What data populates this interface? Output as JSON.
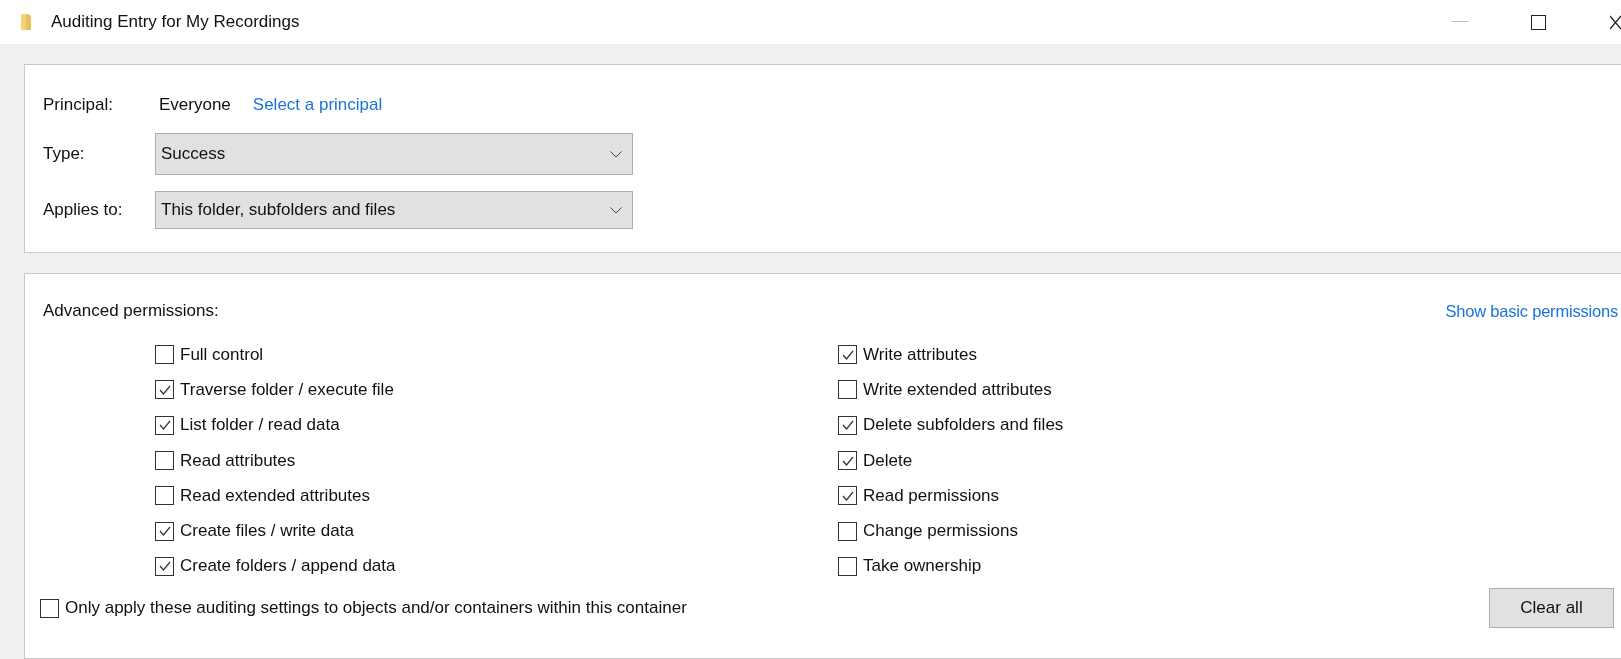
{
  "window": {
    "title": "Auditing Entry for My Recordings"
  },
  "principal": {
    "label": "Principal:",
    "value": "Everyone",
    "link": "Select a principal"
  },
  "type": {
    "label": "Type:",
    "value": "Success"
  },
  "applies_to": {
    "label": "Applies to:",
    "value": "This folder, subfolders and files"
  },
  "permissions": {
    "heading": "Advanced permissions:",
    "toggle_link": "Show basic permissions",
    "left": [
      {
        "label": "Full control",
        "checked": false
      },
      {
        "label": "Traverse folder / execute file",
        "checked": true
      },
      {
        "label": "List folder / read data",
        "checked": true
      },
      {
        "label": "Read attributes",
        "checked": false
      },
      {
        "label": "Read extended attributes",
        "checked": false
      },
      {
        "label": "Create files / write data",
        "checked": true
      },
      {
        "label": "Create folders / append data",
        "checked": true
      }
    ],
    "right": [
      {
        "label": "Write attributes",
        "checked": true
      },
      {
        "label": "Write extended attributes",
        "checked": false
      },
      {
        "label": "Delete subfolders and files",
        "checked": true
      },
      {
        "label": "Delete",
        "checked": true
      },
      {
        "label": "Read permissions",
        "checked": true
      },
      {
        "label": "Change permissions",
        "checked": false
      },
      {
        "label": "Take ownership",
        "checked": false
      }
    ]
  },
  "only_apply": {
    "label": "Only apply these auditing settings to objects and/or containers within this container",
    "checked": false
  },
  "buttons": [
    "Clear all"
  ]
}
